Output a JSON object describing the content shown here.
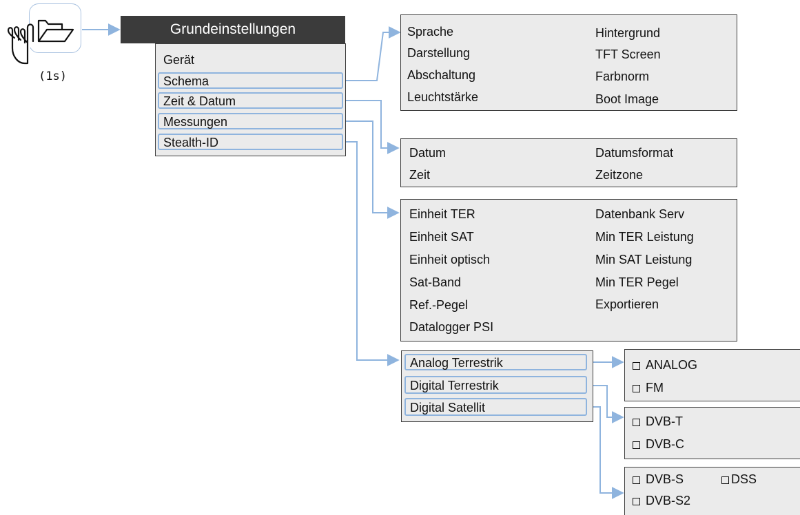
{
  "trigger": {
    "folder_icon": "folder-open-icon",
    "hand_icon": "hand-pointer-icon",
    "duration": "(1s)"
  },
  "main_menu": {
    "title": "Grundeinstellungen",
    "items": [
      "Gerät",
      "Schema",
      "Zeit & Datum",
      "Messungen",
      "Stealth-ID"
    ]
  },
  "schema_panel": {
    "left": [
      "Sprache",
      "Darstellung",
      "Abschaltung",
      "Leuchtstärke"
    ],
    "right": [
      "Hintergrund",
      "TFT Screen",
      "Farbnorm",
      "Boot Image"
    ]
  },
  "datetime_panel": {
    "left": [
      "Datum",
      "Zeit"
    ],
    "right": [
      "Datumsformat",
      "Zeitzone"
    ]
  },
  "measurements_panel": {
    "left": [
      "Einheit TER",
      "Einheit SAT",
      "Einheit optisch",
      "Sat-Band",
      "Ref.-Pegel",
      "Datalogger PSI"
    ],
    "right": [
      "Datenbank Serv",
      "Min TER Leistung",
      "Min SAT Leistung",
      "Min TER Pegel",
      "Exportieren"
    ]
  },
  "stealth_menu": {
    "items": [
      "Analog Terrestrik",
      "Digital Terrestrik",
      "Digital Satellit"
    ]
  },
  "analog_options": [
    "ANALOG",
    "FM"
  ],
  "digital_ter_options": [
    "DVB-T",
    "DVB-C"
  ],
  "digital_sat_options": [
    "DVB-S",
    "DSS",
    "DVB-S2"
  ],
  "colors": {
    "connector": "#8fb4de",
    "title_bar": "#3b3b3b",
    "panel_fill": "#ebebeb"
  }
}
